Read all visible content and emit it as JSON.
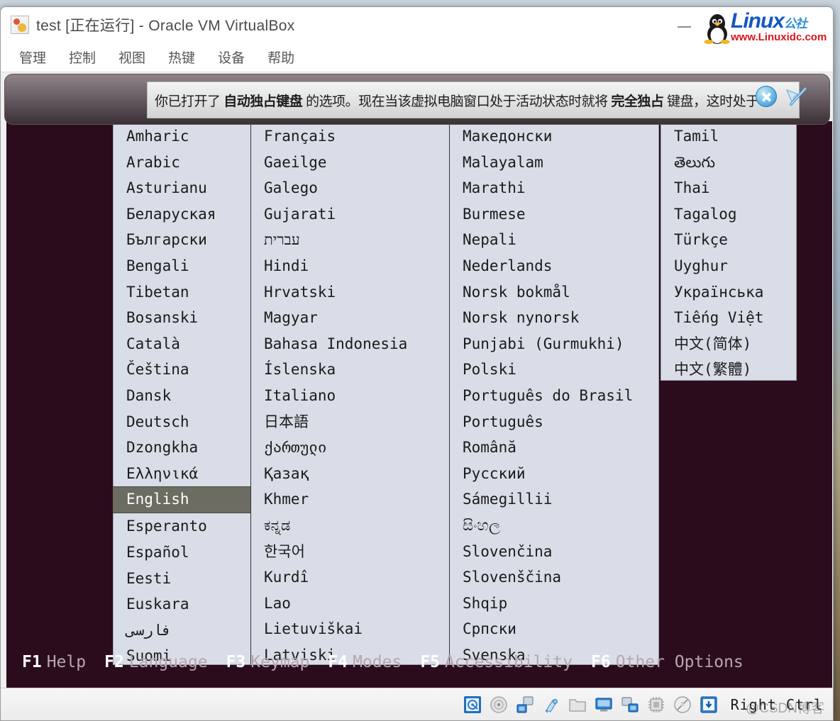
{
  "window": {
    "title": "test [正在运行] - Oracle VM VirtualBox",
    "app_icon": "virtualbox-icon",
    "minimize_label": "—"
  },
  "menubar": {
    "items": [
      {
        "label": "管理",
        "name": "menu-manage"
      },
      {
        "label": "控制",
        "name": "menu-machine"
      },
      {
        "label": "视图",
        "name": "menu-view"
      },
      {
        "label": "热键",
        "name": "menu-input"
      },
      {
        "label": "设备",
        "name": "menu-devices"
      },
      {
        "label": "帮助",
        "name": "menu-help"
      }
    ]
  },
  "notification": {
    "text_part1": "你已打开了 ",
    "text_bold1": "自动独占键盘",
    "text_part2": " 的选项。现在当该虚拟电脑窗口处于活动状态时就将 ",
    "text_bold2": "完全独占",
    "text_part3": " 键盘，这时处于",
    "close_icon": "close-icon",
    "mute_icon": "disable-notification-icon"
  },
  "watermark_top": {
    "brand": "Linux",
    "brand_suffix": "公社",
    "url": "www.Linuxidc.com",
    "logo": "tux-penguin-icon"
  },
  "watermark_bottom": {
    "text": "@CSDN博客"
  },
  "language_list": {
    "selected": "English",
    "columns": [
      {
        "name": "language-column-1",
        "items": [
          "Amharic",
          "Arabic",
          "Asturianu",
          "Беларуская",
          "Български",
          "Bengali",
          "Tibetan",
          "Bosanski",
          "Català",
          "Čeština",
          "Dansk",
          "Deutsch",
          "Dzongkha",
          "Ελληνικά",
          "English",
          "Esperanto",
          "Español",
          "Eesti",
          "Euskara",
          "فارسی",
          "Suomi"
        ]
      },
      {
        "name": "language-column-2",
        "items": [
          "Français",
          "Gaeilge",
          "Galego",
          "Gujarati",
          "עברית",
          "Hindi",
          "Hrvatski",
          "Magyar",
          "Bahasa Indonesia",
          "Íslenska",
          "Italiano",
          "日本語",
          "ქართული",
          "Қазақ",
          "Khmer",
          "ಕನ್ನಡ",
          "한국어",
          "Kurdî",
          "Lao",
          "Lietuviškai",
          "Latviski"
        ]
      },
      {
        "name": "language-column-3",
        "items": [
          "Македонски",
          "Malayalam",
          "Marathi",
          "Burmese",
          "Nepali",
          "Nederlands",
          "Norsk bokmål",
          "Norsk nynorsk",
          "Punjabi (Gurmukhi)",
          "Polski",
          "Português do Brasil",
          "Português",
          "Română",
          "Русский",
          "Sámegillii",
          "සිංහල",
          "Slovenčina",
          "Slovenščina",
          "Shqip",
          "Српски",
          "Svenska"
        ]
      },
      {
        "name": "language-column-4",
        "items": [
          "Tamil",
          "తెలుగు",
          "Thai",
          "Tagalog",
          "Türkçe",
          "Uyghur",
          "Українська",
          "Tiếng Việt",
          "中文(简体)",
          "中文(繁體)"
        ]
      }
    ]
  },
  "function_keys": [
    {
      "key": "F1",
      "desc": "Help",
      "name": "fkey-help"
    },
    {
      "key": "F2",
      "desc": "Language",
      "name": "fkey-language"
    },
    {
      "key": "F3",
      "desc": "Keymap",
      "name": "fkey-keymap"
    },
    {
      "key": "F4",
      "desc": "Modes",
      "name": "fkey-modes"
    },
    {
      "key": "F5",
      "desc": "Accessibility",
      "name": "fkey-accessibility"
    },
    {
      "key": "F6",
      "desc": "Other Options",
      "name": "fkey-other-options"
    }
  ],
  "statusbar": {
    "icons": [
      "hard-disk-icon",
      "optical-disk-icon",
      "network-icon",
      "usb-icon",
      "shared-folder-icon",
      "display-icon",
      "remote-desktop-icon",
      "cpu-icon",
      "mouse-icon",
      "host-key-icon"
    ],
    "host_key": "Right Ctrl"
  },
  "colors": {
    "vm_background": "#2b0c1d",
    "panel_background": "#d9dde7",
    "selection": "#6c6c62",
    "accent_blue": "#1357c4",
    "accent_red": "#d8161c"
  }
}
